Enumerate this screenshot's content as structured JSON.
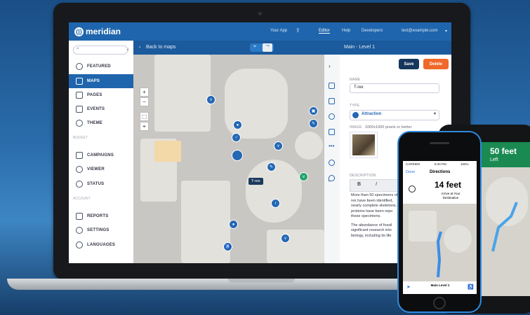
{
  "app": {
    "brand": "meridian",
    "colors": {
      "primary": "#1f65ad",
      "save": "#16365c",
      "delete": "#f0682a"
    }
  },
  "topnav": {
    "your_app": "Your App",
    "editor": "Editor",
    "help": "Help",
    "developers": "Developers",
    "email": "test@example.com"
  },
  "sidebar": {
    "items": [
      {
        "label": "FEATURED",
        "icon": "star-icon"
      },
      {
        "label": "MAPS",
        "icon": "map-icon"
      },
      {
        "label": "PAGES",
        "icon": "pages-icon"
      },
      {
        "label": "EVENTS",
        "icon": "calendar-icon"
      },
      {
        "label": "THEME",
        "icon": "palette-icon"
      },
      {
        "label": "CAMPAIGNS",
        "icon": "megaphone-icon"
      },
      {
        "label": "VIEWER",
        "icon": "eye-icon"
      },
      {
        "label": "STATUS",
        "icon": "info-icon"
      },
      {
        "label": "REPORTS",
        "icon": "bar-chart-icon"
      },
      {
        "label": "SETTINGS",
        "icon": "gear-icon"
      },
      {
        "label": "LANGUAGES",
        "icon": "chat-icon"
      }
    ],
    "headers": [
      "BUDGET",
      "ACCOUNT"
    ]
  },
  "subbar": {
    "back": "Back to maps",
    "title": "Main - Level 1"
  },
  "map": {
    "tooltip": "T-rex"
  },
  "editor": {
    "save": "Save",
    "delete": "Delete",
    "name_label": "NAME",
    "name_value": "T-rex",
    "type_label": "TYPE",
    "type_value": "Attraction",
    "image_label": "IMAGE",
    "image_hint": "1000x1000 pixels or better",
    "description_label": "DESCRIPTION",
    "description_lines": [
      "More than 50 specimens of T-",
      "rex have been identified,",
      "nearly complete skeletons,",
      "proteins have been repo",
      "these specimens.",
      "",
      "The abundance of fossil",
      "significant research into",
      "biology, including its life"
    ]
  },
  "phoneA": {
    "carrier": "CARRIER",
    "time": "8:30 PM",
    "battery": "100%",
    "done": "Done",
    "title": "Directions",
    "distance": "14 feet",
    "instruction": "Arrive at Your Destination",
    "bottom_label": "Main Level 1"
  },
  "phoneB": {
    "distance": "50 feet",
    "sub": "Left"
  }
}
